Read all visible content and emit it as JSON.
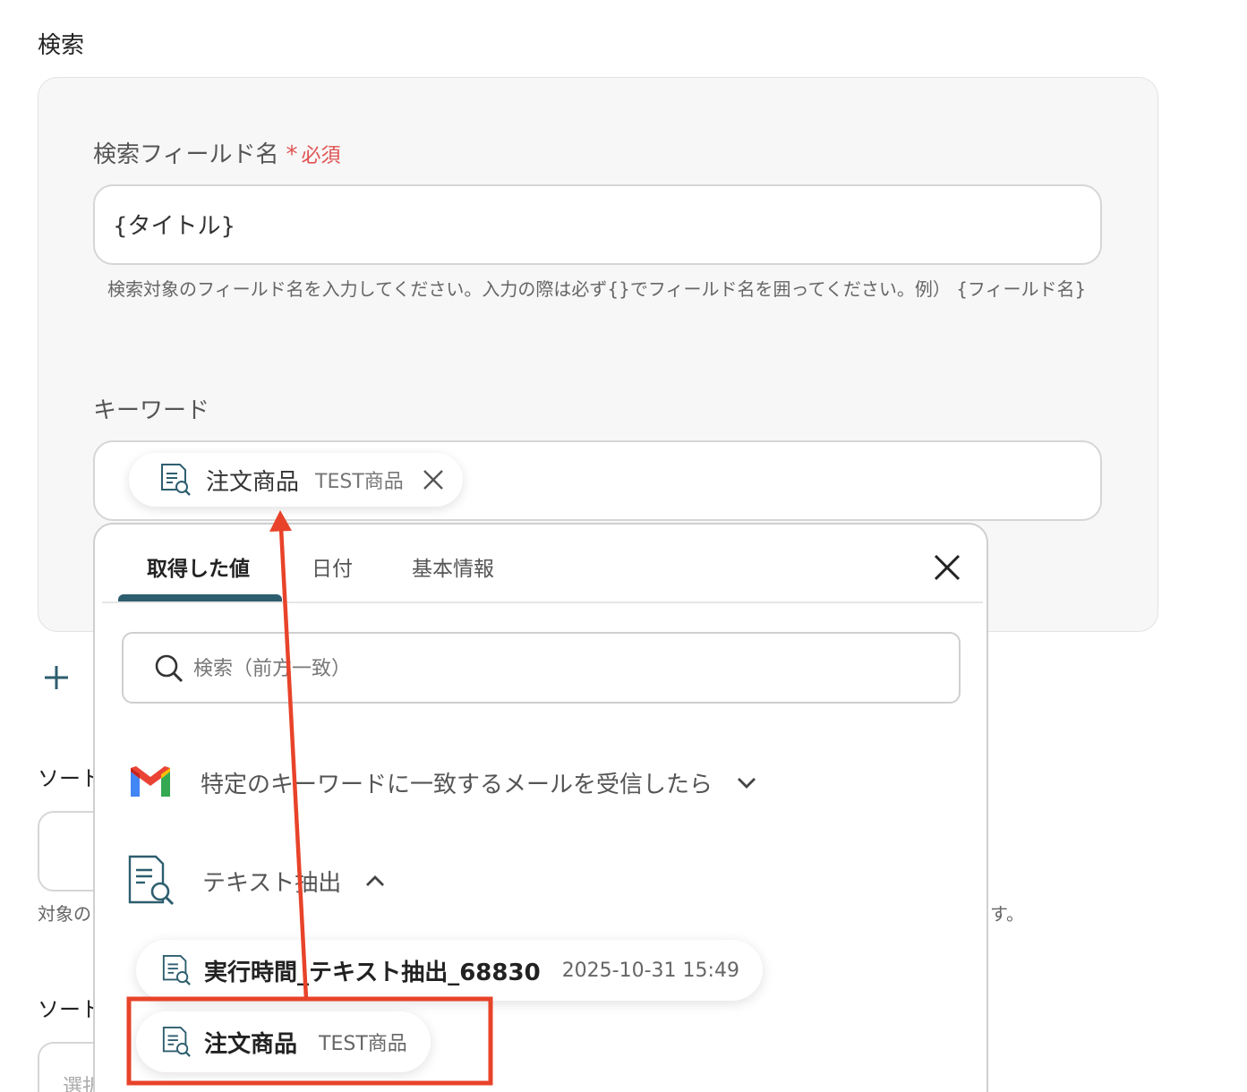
{
  "section": {
    "title": "検索"
  },
  "search_field": {
    "label": "検索フィールド名",
    "required_star": "*",
    "required_text": "必須",
    "value": "{タイトル}",
    "hint": "検索対象のフィールド名を入力してください。入力の際は必ず{}でフィールド名を囲ってください。例） {フィールド名}"
  },
  "keyword": {
    "label": "キーワード",
    "chip": {
      "name": "注文商品",
      "sub": "TEST商品",
      "icon": "document-search-icon"
    }
  },
  "background": {
    "sort_label_1": "ソート",
    "sort_label_2": "ソート",
    "hint_left": "対象の",
    "hint_right": "す。",
    "select_placeholder": "選択"
  },
  "dropdown": {
    "tabs": [
      {
        "label": "取得した値",
        "active": true
      },
      {
        "label": "日付",
        "active": false
      },
      {
        "label": "基本情報",
        "active": false
      }
    ],
    "search_placeholder": "検索（前方一致）",
    "groups": [
      {
        "label": "特定のキーワードに一致するメールを受信したら",
        "icon": "gmail-icon",
        "expanded": false
      },
      {
        "label": "テキスト抽出",
        "icon": "document-search-icon",
        "expanded": true
      }
    ],
    "items": [
      {
        "name": "実行時間_テキスト抽出_68830",
        "sub": "2025-10-31 15:49"
      },
      {
        "name": "注文商品",
        "sub": "TEST商品"
      }
    ]
  },
  "colors": {
    "accent": "#2d5e6e",
    "required": "#e05252",
    "annotation": "#e8432a"
  }
}
